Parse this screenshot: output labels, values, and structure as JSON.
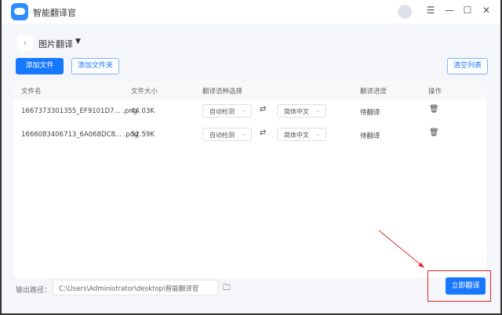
{
  "app": {
    "title": "智能翻译官"
  },
  "window": {
    "menu_icon": "menu-icon",
    "min_icon": "minimize-icon",
    "max_icon": "maximize-icon",
    "close_icon": "close-icon"
  },
  "page": {
    "back": "‹",
    "title": "图片翻译",
    "caret": "▼"
  },
  "toolbar": {
    "add_file": "添加文件",
    "add_folder": "添加文件夹",
    "clear_list": "清空列表"
  },
  "table": {
    "headers": [
      "文件名",
      "文件大小",
      "翻译语种选择",
      "翻译进度",
      "操作"
    ],
    "rows": [
      {
        "name": "1667373301355_EF9101D7... .png",
        "size": "44.03K",
        "source": "自动检测",
        "target": "简体中文",
        "status": "待翻译"
      },
      {
        "name": "1666083406713_6A068DC8... .png",
        "size": "52.59K",
        "source": "自动检测",
        "target": "简体中文",
        "status": "待翻译"
      }
    ]
  },
  "footer": {
    "output_label": "输出路径：",
    "output_path": "C:\\Users\\Administrator\\desktop\\智能翻译官",
    "translate": "立即翻译"
  },
  "colors": {
    "accent": "#1677ff",
    "annotation": "#e8242c"
  }
}
